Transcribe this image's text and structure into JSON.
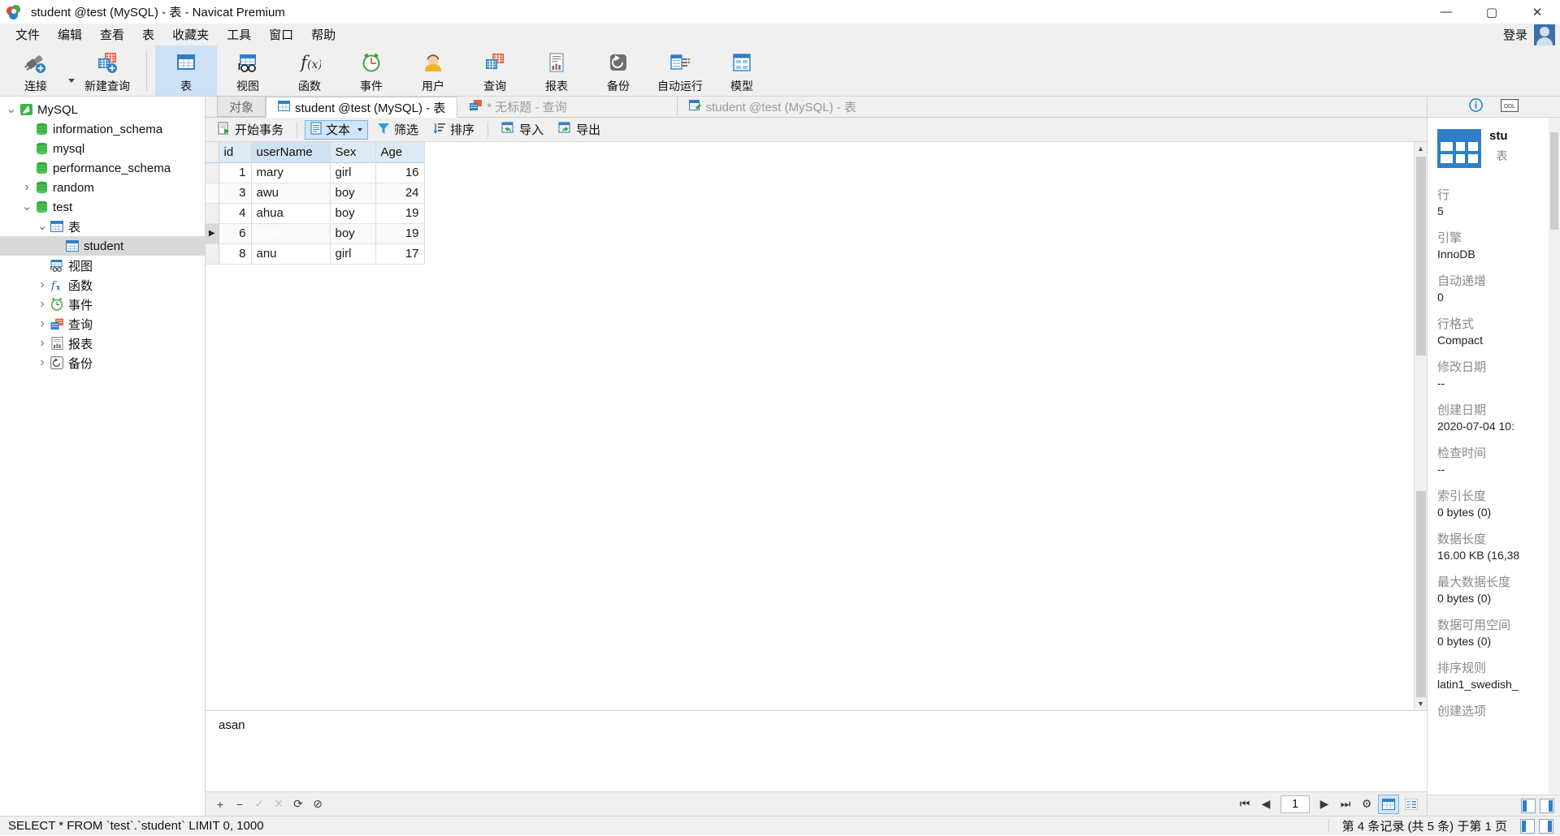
{
  "window": {
    "title": "student @test (MySQL) - 表 - Navicat Premium",
    "minimize": "—",
    "maximize": "▢",
    "close": "✕"
  },
  "menubar": {
    "items": [
      {
        "label": "文件",
        "name": "menu-file"
      },
      {
        "label": "编辑",
        "name": "menu-edit"
      },
      {
        "label": "查看",
        "name": "menu-view"
      },
      {
        "label": "表",
        "name": "menu-table"
      },
      {
        "label": "收藏夹",
        "name": "menu-favorites"
      },
      {
        "label": "工具",
        "name": "menu-tools"
      },
      {
        "label": "窗口",
        "name": "menu-window"
      },
      {
        "label": "帮助",
        "name": "menu-help"
      }
    ],
    "login_label": "登录"
  },
  "toolbar": {
    "items": [
      {
        "label": "连接",
        "icon": "connection-icon"
      },
      {
        "label": "新建查询",
        "icon": "new-query-icon"
      },
      {
        "label": "表",
        "icon": "table-icon"
      },
      {
        "label": "视图",
        "icon": "view-icon"
      },
      {
        "label": "函数",
        "icon": "function-icon"
      },
      {
        "label": "事件",
        "icon": "event-icon"
      },
      {
        "label": "用户",
        "icon": "user-icon"
      },
      {
        "label": "查询",
        "icon": "query-icon"
      },
      {
        "label": "报表",
        "icon": "report-icon"
      },
      {
        "label": "备份",
        "icon": "backup-icon"
      },
      {
        "label": "自动运行",
        "icon": "automation-icon"
      },
      {
        "label": "模型",
        "icon": "model-icon"
      }
    ],
    "selected": "表"
  },
  "sidebar": {
    "items": [
      {
        "label": "MySQL",
        "icon": "connection-icon",
        "indent": 0,
        "chev": "v",
        "selected": false
      },
      {
        "label": "information_schema",
        "icon": "database-icon",
        "indent": 1,
        "chev": "",
        "selected": false
      },
      {
        "label": "mysql",
        "icon": "database-icon",
        "indent": 1,
        "chev": "",
        "selected": false
      },
      {
        "label": "performance_schema",
        "icon": "database-icon",
        "indent": 1,
        "chev": "",
        "selected": false
      },
      {
        "label": "random",
        "icon": "database-icon",
        "indent": 1,
        "chev": ">",
        "selected": false
      },
      {
        "label": "test",
        "icon": "database-icon",
        "indent": 1,
        "chev": "v",
        "selected": false
      },
      {
        "label": "表",
        "icon": "table-icon",
        "indent": 2,
        "chev": "v",
        "selected": false
      },
      {
        "label": "student",
        "icon": "table-icon",
        "indent": 3,
        "chev": "",
        "selected": true
      },
      {
        "label": "视图",
        "icon": "view-icon",
        "indent": 2,
        "chev": "",
        "selected": false
      },
      {
        "label": "函数",
        "icon": "function-icon",
        "indent": 2,
        "chev": ">",
        "selected": false
      },
      {
        "label": "事件",
        "icon": "event-icon",
        "indent": 2,
        "chev": ">",
        "selected": false
      },
      {
        "label": "查询",
        "icon": "query-icon",
        "indent": 2,
        "chev": ">",
        "selected": false
      },
      {
        "label": "报表",
        "icon": "report-icon",
        "indent": 2,
        "chev": ">",
        "selected": false
      },
      {
        "label": "备份",
        "icon": "backup-icon",
        "indent": 2,
        "chev": ">",
        "selected": false
      }
    ]
  },
  "tabs": [
    {
      "label": "对象",
      "icon": "",
      "state": "object"
    },
    {
      "label": "student @test (MySQL) - 表",
      "icon": "table-icon",
      "state": "active"
    },
    {
      "label": "* 无标题 - 查询",
      "icon": "query-icon",
      "state": "dim"
    },
    {
      "label": "student @test (MySQL) - 表",
      "icon": "table-design-icon",
      "state": "dim"
    }
  ],
  "grid_toolbar": {
    "begin_transaction": "开始事务",
    "text": "文本",
    "filter": "筛选",
    "sort": "排序",
    "import": "导入",
    "export": "导出"
  },
  "grid": {
    "columns": [
      "id",
      "userName",
      "Sex",
      "Age"
    ],
    "selected_column": "userName",
    "rows": [
      {
        "id": "1",
        "userName": "mary",
        "Sex": "girl",
        "Age": "16"
      },
      {
        "id": "3",
        "userName": "awu",
        "Sex": "boy",
        "Age": "24"
      },
      {
        "id": "4",
        "userName": "ahua",
        "Sex": "boy",
        "Age": "19"
      },
      {
        "id": "6",
        "userName": "asan",
        "Sex": "boy",
        "Age": "19"
      },
      {
        "id": "8",
        "userName": "anu",
        "Sex": "girl",
        "Age": "17"
      }
    ],
    "selected_row_index": 3,
    "selected_cell_value": "asan",
    "row_marker": "▶"
  },
  "editor": {
    "value": "asan"
  },
  "navbar": {
    "add": "+",
    "remove": "−",
    "confirm": "✓",
    "cancel": "✕",
    "refresh": "⟳",
    "stop": "⊘",
    "first": "⏮",
    "prev": "◀",
    "page": "1",
    "next": "▶",
    "last": "⏭",
    "settings": "⚙"
  },
  "info_panel": {
    "tab_info": "info-icon",
    "tab_ddl": "DDL",
    "object_name": "stu",
    "object_type": "表",
    "fields": [
      {
        "key": "行",
        "value": "5"
      },
      {
        "key": "引擎",
        "value": "InnoDB"
      },
      {
        "key": "自动递增",
        "value": "0"
      },
      {
        "key": "行格式",
        "value": "Compact"
      },
      {
        "key": "修改日期",
        "value": "--"
      },
      {
        "key": "创建日期",
        "value": "2020-07-04 10:"
      },
      {
        "key": "检查时间",
        "value": "--"
      },
      {
        "key": "索引长度",
        "value": "0 bytes (0)"
      },
      {
        "key": "数据长度",
        "value": "16.00 KB (16,38"
      },
      {
        "key": "最大数据长度",
        "value": "0 bytes (0)"
      },
      {
        "key": "数据可用空间",
        "value": "0 bytes (0)"
      },
      {
        "key": "排序规则",
        "value": "latin1_swedish_"
      },
      {
        "key": "创建选项",
        "value": ""
      }
    ]
  },
  "statusbar": {
    "sql": "SELECT * FROM `test`.`student` LIMIT 0, 1000",
    "record_info": "第 4 条记录 (共 5 条) 于第 1 页"
  },
  "colors": {
    "accent": "#2f7fc6",
    "selection": "#0a7cd5",
    "toolbar_bg": "#f0f0f0",
    "header_bg": "#ddeaf6"
  }
}
